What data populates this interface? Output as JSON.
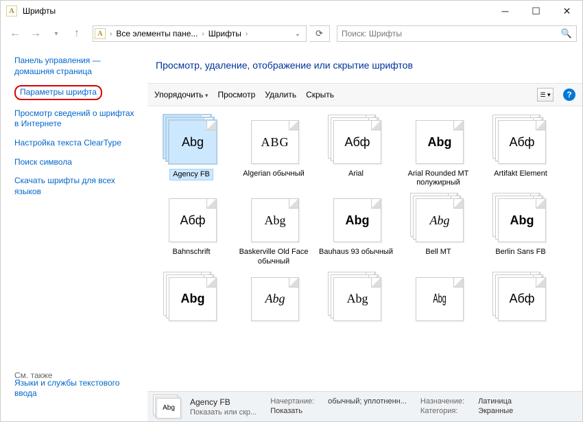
{
  "window": {
    "title": "Шрифты"
  },
  "nav": {
    "breadcrumb": [
      "Все элементы пане...",
      "Шрифты"
    ],
    "searchPlaceholder": "Поиск: Шрифты"
  },
  "sidebar": {
    "home": "Панель управления — домашняя страница",
    "links": [
      "Параметры шрифта",
      "Просмотр сведений о шрифтах в Интернете",
      "Настройка текста ClearType",
      "Поиск символа",
      "Скачать шрифты для всех языков"
    ],
    "seeAlsoLabel": "См. также",
    "seeAlsoLink": "Языки и службы текстового ввода"
  },
  "main": {
    "heading": "Просмотр, удаление, отображение или скрытие шрифтов",
    "toolbar": {
      "organize": "Упорядочить",
      "preview": "Просмотр",
      "delete": "Удалить",
      "hide": "Скрыть"
    }
  },
  "fonts": [
    {
      "label": "Agency FB",
      "sample": "Abg",
      "stack": true,
      "selected": true,
      "style": "font-family:'Agency FB',sans-serif;font-stretch:condensed"
    },
    {
      "label": "Algerian обычный",
      "sample": "ABG",
      "stack": false,
      "style": "font-family:serif;font-variant:small-caps;letter-spacing:1px"
    },
    {
      "label": "Arial",
      "sample": "Абф",
      "stack": true,
      "style": "font-family:Arial"
    },
    {
      "label": "Arial Rounded MT полужирный",
      "sample": "Abg",
      "stack": false,
      "style": "font-family:'Arial Rounded MT Bold',Arial;font-weight:bold"
    },
    {
      "label": "Artifakt Element",
      "sample": "Абф",
      "stack": true,
      "style": "font-family:sans-serif"
    },
    {
      "label": "Bahnschrift",
      "sample": "Абф",
      "stack": false,
      "style": "font-family:Bahnschrift,sans-serif"
    },
    {
      "label": "Baskerville Old Face обычный",
      "sample": "Abg",
      "stack": false,
      "style": "font-family:'Baskerville Old Face',serif"
    },
    {
      "label": "Bauhaus 93 обычный",
      "sample": "Abg",
      "stack": false,
      "style": "font-family:'Bauhaus 93',sans-serif;font-weight:900"
    },
    {
      "label": "Bell MT",
      "sample": "Abg",
      "stack": true,
      "style": "font-family:'Bell MT',serif;font-style:italic"
    },
    {
      "label": "Berlin Sans FB",
      "sample": "Abg",
      "stack": true,
      "style": "font-family:'Berlin Sans FB',sans-serif;font-weight:bold"
    },
    {
      "label": "",
      "sample": "Abg",
      "stack": true,
      "style": "font-family:sans-serif;font-weight:900"
    },
    {
      "label": "",
      "sample": "Abg",
      "stack": false,
      "style": "font-family:'Brush Script MT',cursive;font-style:italic"
    },
    {
      "label": "",
      "sample": "Abg",
      "stack": true,
      "style": "font-family:serif"
    },
    {
      "label": "",
      "sample": "Abg",
      "stack": false,
      "style": "font-family:sans-serif;font-stretch:ultra-condensed;transform:scaleX(0.6)"
    },
    {
      "label": "",
      "sample": "Абф",
      "stack": true,
      "style": "font-family:sans-serif"
    }
  ],
  "details": {
    "name": "Agency FB",
    "styleLabel": "Начертание:",
    "styleValue": "обычный; уплотненн...",
    "showLabel": "Показать или скр...",
    "showValue": "Показать",
    "designLabel": "Назначение:",
    "designValue": "Латиница",
    "catLabel": "Категория:",
    "catValue": "Экранные",
    "thumbSample": "Abg"
  }
}
